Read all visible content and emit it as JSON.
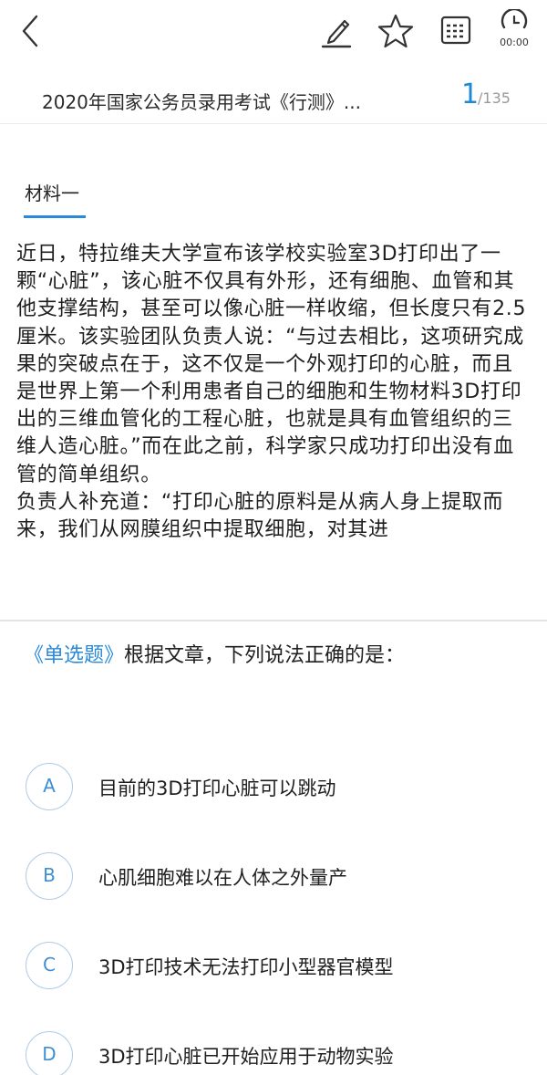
{
  "toolbar": {
    "back_icon": "chevron-left-icon",
    "annotate_icon": "pencil-icon",
    "favorite_icon": "star-icon",
    "answer_sheet_icon": "grid-icon",
    "timer_icon": "clock-icon",
    "timer_text": "00:00"
  },
  "header": {
    "exam_title": "2020年国家公务员录用考试《行测》...",
    "page_current": "1",
    "page_total": "/135"
  },
  "material": {
    "tab_label": "材料一",
    "paragraphs": [
      "近日，特拉维夫大学宣布该学校实验室3D打印出了一颗“心脏”，该心脏不仅具有外形，还有细胞、血管和其他支撑结构，甚至可以像心脏一样收缩，但长度只有2.5厘米。该实验团队负责人说：“与过去相比，这项研究成果的突破点在于，这不仅是一个外观打印的心脏，而且是世界上第一个利用患者自己的细胞和生物材料3D打印出的三维血管化的工程心脏，也就是具有血管组织的三维人造心脏。”而在此之前，科学家只成功打印出没有血管的简单组织。",
      "负责人补充道：“打印心脏的原料是从病人身上提取而来，我们从网膜组织中提取细胞，对其进"
    ]
  },
  "question": {
    "type_label": "《单选题》",
    "stem": "根据文章，下列说法正确的是："
  },
  "options": [
    {
      "letter": "A",
      "text": "目前的3D打印心脏可以跳动"
    },
    {
      "letter": "B",
      "text": "心肌细胞难以在人体之外量产"
    },
    {
      "letter": "C",
      "text": "3D打印技术无法打印小型器官模型"
    },
    {
      "letter": "D",
      "text": "3D打印心脏已开始应用于动物实验"
    }
  ],
  "colors": {
    "accent": "#2a8ad8",
    "option_border": "#aecbe6",
    "divider": "#e4e4e4"
  }
}
